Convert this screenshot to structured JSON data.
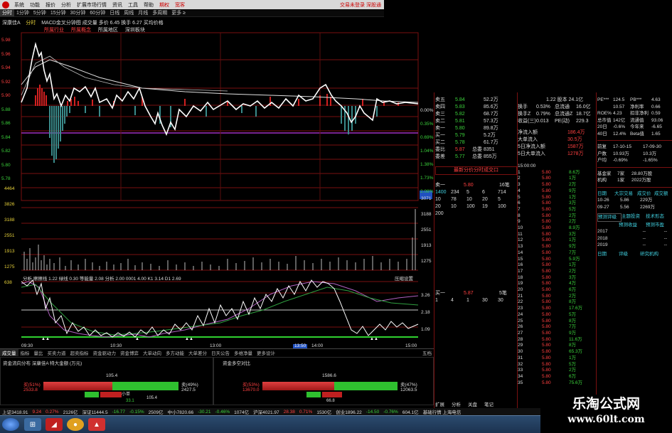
{
  "menu": {
    "items": [
      "系统",
      "功能",
      "报价",
      "分析",
      "扩展市场行情",
      "资讯",
      "工具",
      "帮助"
    ],
    "highlight": [
      "期权",
      "宽客"
    ],
    "right_label": "交易未登录  深股通"
  },
  "timeframes": [
    "分时",
    "1分钟",
    "5分钟",
    "15分钟",
    "30分钟",
    "60分钟",
    "日线",
    "周线",
    "月线",
    "多周期",
    "更多 ≥"
  ],
  "chart": {
    "header_left": "深康佳A",
    "header_tag": "分时",
    "header_metrics": "MACD金叉分钟图 成交量 多价 6.45 换手 6.27 买均价格",
    "sub_tags": [
      "所属行业",
      "所属概念",
      "所属地区",
      "深圳板块"
    ],
    "price_ticks": [
      "5.98",
      "5.96",
      "5.94",
      "5.92",
      "5.90",
      "5.88",
      "5.86",
      "5.84",
      "5.82",
      "5.80",
      "5.78",
      "5.76"
    ],
    "pct_ticks": [
      "0.00%",
      "0.35%",
      "0.69%",
      "1.04%",
      "1.38%",
      "1.73%",
      "2.08%",
      "2.42%"
    ],
    "volume_ticks": [
      "4464",
      "3826",
      "3188",
      "2551",
      "1913",
      "1275",
      "638"
    ],
    "volume_right": [
      "3071",
      "3188",
      "2551",
      "1913",
      "1275"
    ],
    "indicator_header": "分析 擦擦线 1.22 绿线 0.30 等能量 2.08 分析 2.00 0001 4.00  K1 3.14 D1 2.69",
    "indicator_right_label": "压缩设置",
    "indicator_ticks": [
      "3.26",
      "2.18",
      "1.09"
    ],
    "time_labels": [
      "09:30",
      "10:30",
      "13:00",
      "13:50",
      "14:00",
      "15:00"
    ],
    "time_highlight": "13:50"
  },
  "bottom_tabs": [
    "成交量",
    "指标",
    "量比",
    "买卖力道",
    "超卖指标",
    "资金驱动力",
    "资金博弈",
    "大单动向",
    "多方动能",
    "大单差分",
    "日天公告",
    "多维净量",
    "更多设计"
  ],
  "bottom_tab_right": "五档",
  "fund_left": {
    "title": "资金流向分布",
    "stock": "深康佳A",
    "sub": "特大金额 (万元)",
    "top_value": "105.4",
    "inflow_label": "买(51%)",
    "inflow_value": "2533.8",
    "outflow_label": "卖(49%)",
    "outflow_value": "2427.5",
    "mid_labels": [
      "小单",
      "中单"
    ],
    "mid_values": [
      "33.1",
      "105.4"
    ],
    "inflow_pct": 51
  },
  "fund_right": {
    "title": "资金多空对比",
    "top_value": "1586.6",
    "inflow_label": "买(53%)",
    "inflow_value": "13670.0",
    "outflow_label": "卖(47%)",
    "outflow_value": "12063.5",
    "mid_value": "66.8",
    "inflow_pct": 53
  },
  "order_book": {
    "sells": [
      {
        "label": "卖五",
        "price": "5.84",
        "vol": "52.2万"
      },
      {
        "label": "卖四",
        "price": "5.83",
        "vol": "85.6万"
      },
      {
        "label": "卖三",
        "price": "5.82",
        "vol": "68.7万"
      },
      {
        "label": "卖二",
        "price": "5.81",
        "vol": "57.3万"
      },
      {
        "label": "卖一",
        "price": "5.80",
        "vol": "89.8万"
      }
    ],
    "buys": [
      {
        "label": "买一",
        "price": "5.79",
        "vol": "5.2万"
      },
      {
        "label": "买二",
        "price": "5.78",
        "vol": "61.7万"
      }
    ],
    "ratio": {
      "label": "委比",
      "value": "5.87",
      "total_label": "总委",
      "total": "8351"
    },
    "diff": {
      "label": "委差",
      "value": "5.77",
      "total_label": "总委",
      "total": "855万"
    },
    "queue_title": "最新分价分时成交口",
    "queue_head": [
      "卖一",
      "5.80",
      "16笔"
    ],
    "queue_rows": [
      [
        "1400",
        "234",
        "5",
        "6",
        "714"
      ],
      [
        "10",
        "78",
        "10",
        "20",
        "5"
      ],
      [
        "20",
        "10",
        "100",
        "19",
        "100"
      ],
      [
        "200",
        "",
        "",
        "",
        ""
      ]
    ],
    "queue2_head": [
      "买一",
      "5.87",
      "5笔"
    ],
    "queue2_rows": [
      [
        "1",
        "4",
        "1",
        "30",
        "30"
      ]
    ]
  },
  "stats": {
    "rows": [
      {
        "l": "换手",
        "v": "0.53%",
        "l2": "总流通",
        "v2": "16.0亿"
      },
      {
        "l": "换手Z",
        "v": "0.79%",
        "l2": "总流通Z",
        "v2": "18.7亿"
      },
      {
        "l": "收益(三)",
        "v": "0.013",
        "l2": "PE(动)",
        "v2": "229.3"
      }
    ],
    "top_partial": "1.22 股本 24.1亿",
    "flows": [
      {
        "l": "净流入额",
        "v": "186.4万"
      },
      {
        "l": "大单流入",
        "v": "30.5万"
      },
      {
        "l": "5日净流入额",
        "v": "1587万"
      },
      {
        "l": "5日大单流入",
        "v": "1278万"
      }
    ]
  },
  "ticks": {
    "time_label": "15:00:00",
    "rows": [
      [
        "1",
        "5.80",
        "8.6万"
      ],
      [
        "2",
        "5.80",
        "1万"
      ],
      [
        "3",
        "5.80",
        "2万"
      ],
      [
        "4",
        "5.80",
        "9万"
      ],
      [
        "5",
        "5.80",
        "1万"
      ],
      [
        "6",
        "5.80",
        "3万"
      ],
      [
        "7",
        "5.80",
        "5万"
      ],
      [
        "8",
        "5.80",
        "2万"
      ],
      [
        "9",
        "5.80",
        "2万"
      ],
      [
        "10",
        "5.80",
        "8.9万"
      ],
      [
        "11",
        "5.80",
        "3万"
      ],
      [
        "12",
        "5.80",
        "1万"
      ],
      [
        "13",
        "5.80",
        "9万"
      ],
      [
        "14",
        "5.80",
        "7万"
      ],
      [
        "15",
        "5.80",
        "5.9万"
      ],
      [
        "16",
        "5.80",
        "1万"
      ],
      [
        "17",
        "5.80",
        "2万"
      ],
      [
        "18",
        "5.80",
        "3万"
      ],
      [
        "19",
        "5.80",
        "4万"
      ],
      [
        "20",
        "5.80",
        "6万"
      ],
      [
        "21",
        "5.80",
        "2万"
      ],
      [
        "22",
        "5.80",
        "8万"
      ],
      [
        "23",
        "5.80",
        "17.6万"
      ],
      [
        "24",
        "5.80",
        "5万"
      ],
      [
        "25",
        "5.80",
        "8万"
      ],
      [
        "26",
        "5.80",
        "7万"
      ],
      [
        "27",
        "5.80",
        "9万"
      ],
      [
        "28",
        "5.80",
        "11.6万"
      ],
      [
        "29",
        "5.80",
        "8万"
      ],
      [
        "30",
        "5.80",
        "65.3万"
      ],
      [
        "31",
        "5.80",
        "1万"
      ],
      [
        "32",
        "5.80",
        "5万"
      ],
      [
        "33",
        "5.80",
        "2万"
      ],
      [
        "34",
        "5.80",
        "6万"
      ],
      [
        "35",
        "5.80",
        "75.6万"
      ]
    ]
  },
  "finance": {
    "top": [
      {
        "l": "PE***",
        "v": "124.5",
        "l2": "PB***",
        "v2": "4.63"
      },
      {
        "l": "",
        "v": "10.57",
        "l2": "净利率",
        "v2": "0.66"
      },
      {
        "l": "ROE%",
        "v": "4.23",
        "l2": "扣非净利",
        "v2": "0.59"
      },
      {
        "l": "总市值",
        "v": "142亿",
        "l2": "流通值",
        "v2": "93.06"
      },
      {
        "l": "20日",
        "v": "-0.6%",
        "l2": "今年来",
        "v2": "-6.65"
      },
      {
        "l": "40日",
        "v": "12.4%",
        "l2": "Beta值",
        "v2": "1.65"
      }
    ],
    "dates": [
      {
        "l": "前复",
        "v": "17-10-15",
        "v2": "17-09-30"
      },
      {
        "l": "户数",
        "v": "10.93万",
        "v2": "10.3万"
      },
      {
        "l": "户均",
        "v": "-0.69%",
        "v2": "-1.65%"
      }
    ],
    "mid": [
      {
        "l": "基金家",
        "v": "7家",
        "v2": "28.80万股"
      },
      {
        "l": "机构",
        "v": "1家",
        "v2": "2022万股"
      }
    ],
    "trade_head": [
      "日期",
      "大宗交易",
      "成交价",
      "成交额"
    ],
    "trade_rows": [
      [
        "10-26",
        "5.86",
        "229万"
      ],
      [
        "09-27",
        "5.56",
        "2269万"
      ]
    ],
    "tabs": [
      "预测评级",
      "主题投资",
      "技术形态"
    ],
    "forecast_head": [
      "",
      "预测收益",
      "预测市盈"
    ],
    "forecast_rows": [
      [
        "2017",
        "--",
        "--"
      ],
      [
        "2018",
        "--",
        "--"
      ],
      [
        "2019",
        "--",
        "--"
      ]
    ],
    "rating_tabs": [
      "日期",
      "评级",
      "研究机构"
    ]
  },
  "statusbar": [
    {
      "t": "上证3418.91",
      "c": "w"
    },
    {
      "t": "9.24",
      "c": "r"
    },
    {
      "t": "0.27%",
      "c": "r"
    },
    {
      "t": "2126亿",
      "c": "w"
    },
    {
      "t": "深证11444.5",
      "c": "w"
    },
    {
      "t": "-16.77",
      "c": "g"
    },
    {
      "t": "-0.15%",
      "c": "g"
    },
    {
      "t": "2509亿",
      "c": "w"
    },
    {
      "t": "中小7820.66",
      "c": "w"
    },
    {
      "t": "-30.21",
      "c": "g"
    },
    {
      "t": "-0.46%",
      "c": "g"
    },
    {
      "t": "1074亿",
      "c": "w"
    },
    {
      "t": "沪深4021.97",
      "c": "w"
    },
    {
      "t": "28.38",
      "c": "r"
    },
    {
      "t": "0.71%",
      "c": "r"
    },
    {
      "t": "1530亿",
      "c": "w"
    },
    {
      "t": "创业1896.22",
      "c": "w"
    },
    {
      "t": "-14.50",
      "c": "g"
    },
    {
      "t": "-0.76%",
      "c": "g"
    },
    {
      "t": "604.1亿",
      "c": "w"
    },
    {
      "t": "基础行情 上海电信",
      "c": "w"
    }
  ],
  "right_side_tabs": [
    "扩展",
    "分析",
    "关盘",
    "笔记"
  ],
  "watermark": {
    "line1": "乐淘公式网",
    "line2": "www.60lt.com"
  }
}
